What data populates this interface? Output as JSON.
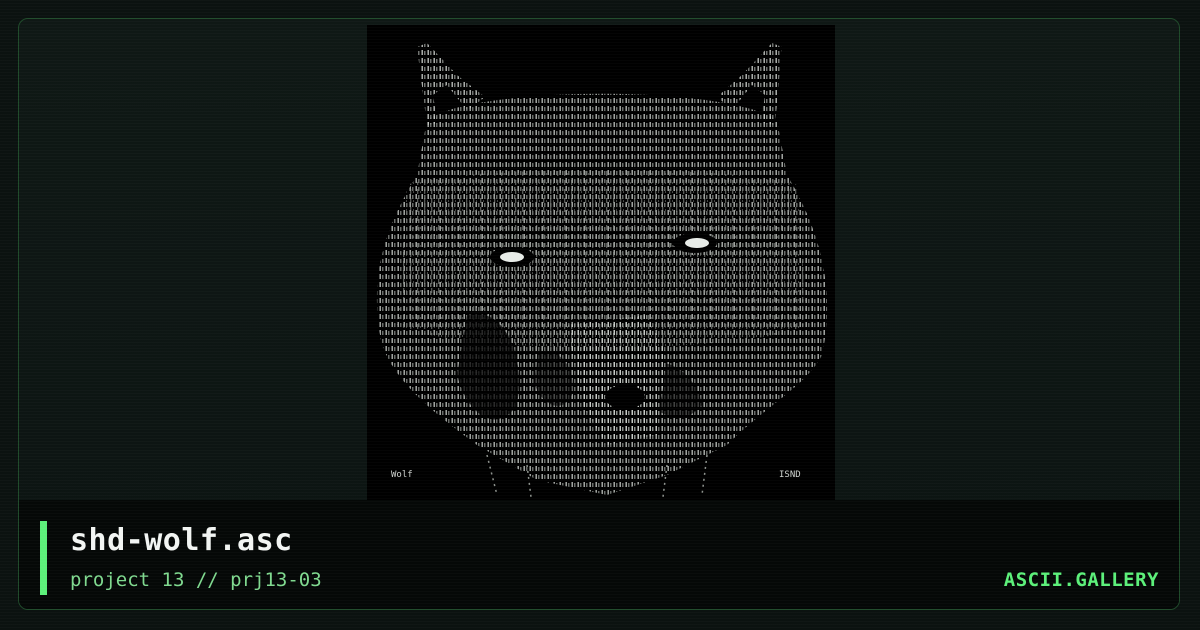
{
  "artwork": {
    "image_icon": "ascii-wolf-head",
    "corner_left_label": "Wolf",
    "corner_right_label": "ISND"
  },
  "footer": {
    "title": "shd-wolf.asc",
    "subtitle": "project 13 // prj13-03",
    "brand": "ASCII.GALLERY"
  },
  "colors": {
    "accent": "#5cf07a",
    "subtitle": "#7fd98f",
    "border": "#1f4a2a",
    "background": "#0b1210"
  }
}
